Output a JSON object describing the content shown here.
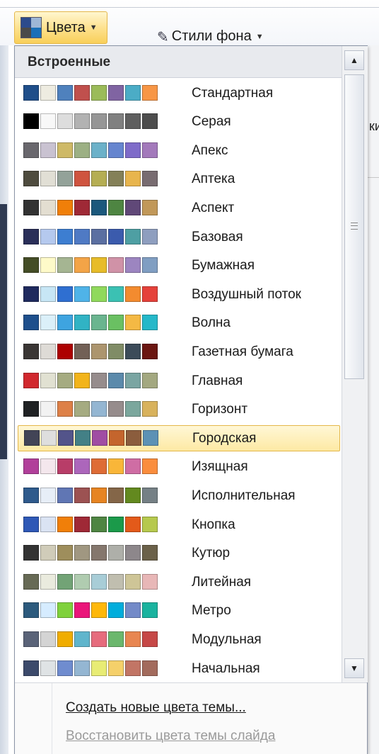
{
  "ribbon": {
    "colors_button_label": "Цвета",
    "background_styles_label": "Стили фона",
    "right_clip_text": "ки"
  },
  "gallery": {
    "section_header": "Встроенные",
    "selected_index": 12,
    "themes": [
      {
        "name": "Стандартная",
        "colors": [
          "#1f4e8a",
          "#eeece1",
          "#4f81bd",
          "#c0504d",
          "#9bbb59",
          "#8064a2",
          "#4bacc6",
          "#f79646"
        ]
      },
      {
        "name": "Серая",
        "colors": [
          "#000000",
          "#f8f8f8",
          "#dddddd",
          "#b2b2b2",
          "#969696",
          "#808080",
          "#5f5f5f",
          "#4d4d4d"
        ]
      },
      {
        "name": "Апекс",
        "colors": [
          "#69676d",
          "#c9c2d1",
          "#ceb966",
          "#9cb084",
          "#6bb1c9",
          "#6585cf",
          "#7e6bc9",
          "#a379bb"
        ]
      },
      {
        "name": "Аптека",
        "colors": [
          "#4e4b3e",
          "#e1dfd5",
          "#93a299",
          "#cf543f",
          "#b5ae53",
          "#848058",
          "#e8b54d",
          "#786c71"
        ]
      },
      {
        "name": "Аспект",
        "colors": [
          "#323232",
          "#e3ded1",
          "#f07f09",
          "#9f2936",
          "#1b587c",
          "#4e8542",
          "#604878",
          "#c19859"
        ]
      },
      {
        "name": "Базовая",
        "colors": [
          "#2a2f59",
          "#b5c9ee",
          "#3d7ed1",
          "#4f7ac4",
          "#5b6fa1",
          "#3b5bad",
          "#4e9fa3",
          "#8e9ebf"
        ]
      },
      {
        "name": "Бумажная",
        "colors": [
          "#444d26",
          "#fefac9",
          "#a5b592",
          "#f3a447",
          "#e7bc29",
          "#d092a7",
          "#9c85c0",
          "#809ec2"
        ]
      },
      {
        "name": "Воздушный поток",
        "colors": [
          "#1f2a5e",
          "#c7e6f5",
          "#2f6fd1",
          "#4fb3e8",
          "#90d95c",
          "#3bc1b3",
          "#f38b2f",
          "#e5413a"
        ]
      },
      {
        "name": "Волна",
        "colors": [
          "#1e4f8c",
          "#dbf0f9",
          "#3ea4e0",
          "#31b3c4",
          "#6ab58f",
          "#6ac062",
          "#f4b944",
          "#25b8c9"
        ]
      },
      {
        "name": "Газетная бумага",
        "colors": [
          "#3a3634",
          "#dedbd6",
          "#ad0101",
          "#726056",
          "#ac956e",
          "#808c66",
          "#3c4b59",
          "#6b1611"
        ]
      },
      {
        "name": "Главная",
        "colors": [
          "#d1282e",
          "#e1e1d2",
          "#a5ab81",
          "#f2b41a",
          "#968c8c",
          "#5b8aab",
          "#7aa5a2",
          "#a3a880"
        ]
      },
      {
        "name": "Горизонт",
        "colors": [
          "#1f2123",
          "#f2f2f2",
          "#dd8047",
          "#a5ab81",
          "#94b6d2",
          "#968c8c",
          "#7ba79d",
          "#d8b25c"
        ]
      },
      {
        "name": "Городская",
        "colors": [
          "#424456",
          "#dedede",
          "#53548a",
          "#438086",
          "#a04da3",
          "#c4652d",
          "#8b5d3d",
          "#5c92b5"
        ]
      },
      {
        "name": "Изящная",
        "colors": [
          "#b13f9a",
          "#f4e7ed",
          "#b83d68",
          "#ac66bb",
          "#de6c36",
          "#f9b639",
          "#cf6da4",
          "#fa8d3d"
        ]
      },
      {
        "name": "Исполнительная",
        "colors": [
          "#2e5a8c",
          "#e7eef7",
          "#6076b4",
          "#9c5252",
          "#e68422",
          "#846648",
          "#63891f",
          "#758085"
        ]
      },
      {
        "name": "Кнопка",
        "colors": [
          "#2e58b6",
          "#dae3f3",
          "#f07f09",
          "#9f2936",
          "#4e8542",
          "#1b9a4a",
          "#e35a1a",
          "#b6c94d"
        ]
      },
      {
        "name": "Кутюр",
        "colors": [
          "#333333",
          "#d0ccb9",
          "#9e8e5c",
          "#a09781",
          "#85776d",
          "#aeafa9",
          "#8d878b",
          "#6b6149"
        ]
      },
      {
        "name": "Литейная",
        "colors": [
          "#676a55",
          "#eaebde",
          "#72a376",
          "#b0ccb0",
          "#a8cdd7",
          "#c0beaf",
          "#cec597",
          "#e8b7b7"
        ]
      },
      {
        "name": "Метро",
        "colors": [
          "#2c5a7d",
          "#d6ecff",
          "#7fd13b",
          "#ea157a",
          "#feb80a",
          "#00addc",
          "#738ac8",
          "#1ab39f"
        ]
      },
      {
        "name": "Модульная",
        "colors": [
          "#5a6378",
          "#d4d4d4",
          "#f0ad00",
          "#60b5cc",
          "#e66c7d",
          "#6bb76d",
          "#e88651",
          "#c64847"
        ]
      },
      {
        "name": "Начальная",
        "colors": [
          "#3c4a6b",
          "#dfe3e5",
          "#6f8ccf",
          "#94b6d2",
          "#e8ec74",
          "#f5d06a",
          "#c27565",
          "#a36b5d"
        ]
      }
    ]
  },
  "footer": {
    "create_label": "Создать новые цвета темы...",
    "restore_label": "Восстановить цвета темы слайда"
  },
  "icons": {
    "colors": "color-palette-icon",
    "background_styles": "paint-bucket-icon",
    "dropdown": "chevron-down-icon",
    "scroll_up": "scroll-up-arrow-icon",
    "scroll_down": "scroll-down-arrow-icon"
  }
}
